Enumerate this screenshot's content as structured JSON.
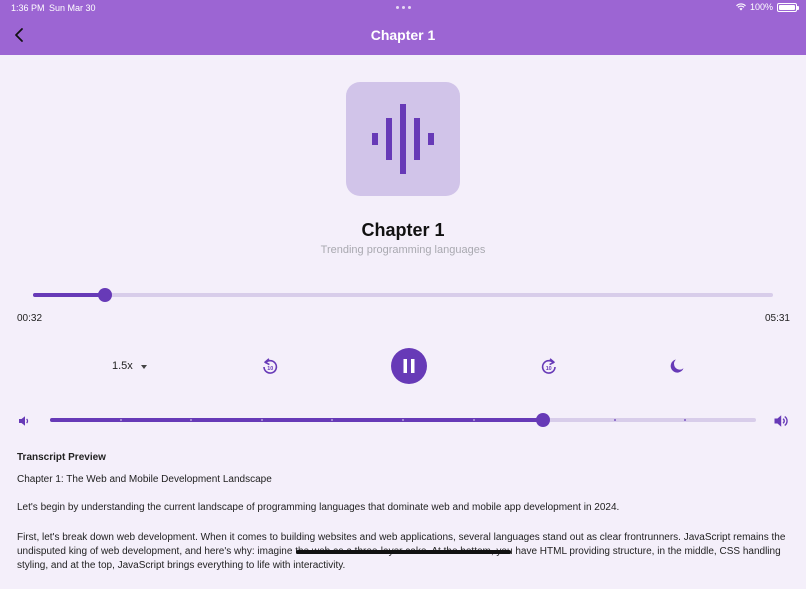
{
  "status_bar": {
    "time": "1:36 PM",
    "date": "Sun Mar 30",
    "battery": "100%"
  },
  "app_bar": {
    "title": "Chapter 1",
    "back_icon": "chevron-left-icon"
  },
  "track": {
    "title": "Chapter 1",
    "subtitle": "Trending programming languages",
    "artwork_icon": "audio-waveform-icon"
  },
  "playback": {
    "current_time": "00:32",
    "total_time": "05:31",
    "progress": 0.097,
    "speed": "1.5x",
    "rewind_seconds": "10",
    "forward_seconds": "10",
    "state": "playing"
  },
  "volume": {
    "level": 0.698,
    "divisions": 10
  },
  "transcript": {
    "heading": "Transcript Preview",
    "paragraphs": [
      "Chapter 1: The Web and Mobile Development Landscape",
      "Let's begin by understanding the current landscape of programming languages that dominate web and mobile app development in 2024.",
      "First, let's break down web development. When it comes to building websites and web applications, several languages stand out as clear frontrunners. JavaScript remains the undisputed king of web development, and here's why: imagine the web as a three-layer cake. At the bottom, you have HTML providing structure, in the middle, CSS handling styling, and at the top, JavaScript brings everything to life with interactivity."
    ]
  },
  "colors": {
    "app_bar": "#9c65d3",
    "accent": "#673ab7",
    "track_inactive": "#d8cdea",
    "background": "#f4effa",
    "artwork_bg": "#d1c4e9"
  }
}
